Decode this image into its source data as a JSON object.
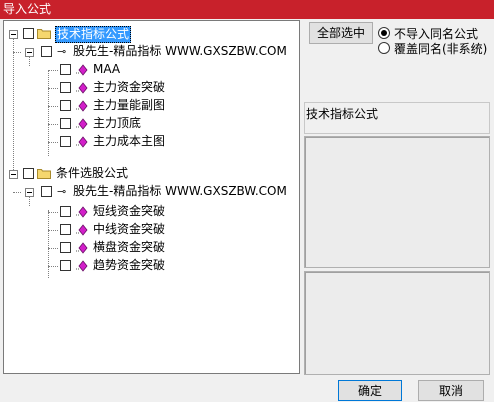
{
  "window": {
    "title": "导入公式"
  },
  "tree": {
    "groups": [
      {
        "label": "技术指标公式",
        "selected": true,
        "child": {
          "label": "股先生-精品指标 WWW.GXSZBW.COM",
          "items": [
            "MAA",
            "主力资金突破",
            "主力量能副图",
            "主力顶底",
            "主力成本主图"
          ]
        }
      },
      {
        "label": "条件选股公式",
        "selected": false,
        "child": {
          "label": "股先生-精品指标 WWW.GXSZBW.COM",
          "items": [
            "短线资金突破",
            "中线资金突破",
            "横盘资金突破",
            "趋势资金突破"
          ]
        }
      }
    ]
  },
  "right": {
    "select_all_label": "全部选中",
    "option_skip": "不导入同名公式",
    "option_overwrite": "覆盖同名(非系统)",
    "info_label": "技术指标公式"
  },
  "footer": {
    "ok_label": "确定",
    "cancel_label": "取消"
  },
  "colors": {
    "titlebar": "#c8212b",
    "selection": "#3399ff",
    "diamond": "#d21fc9"
  }
}
